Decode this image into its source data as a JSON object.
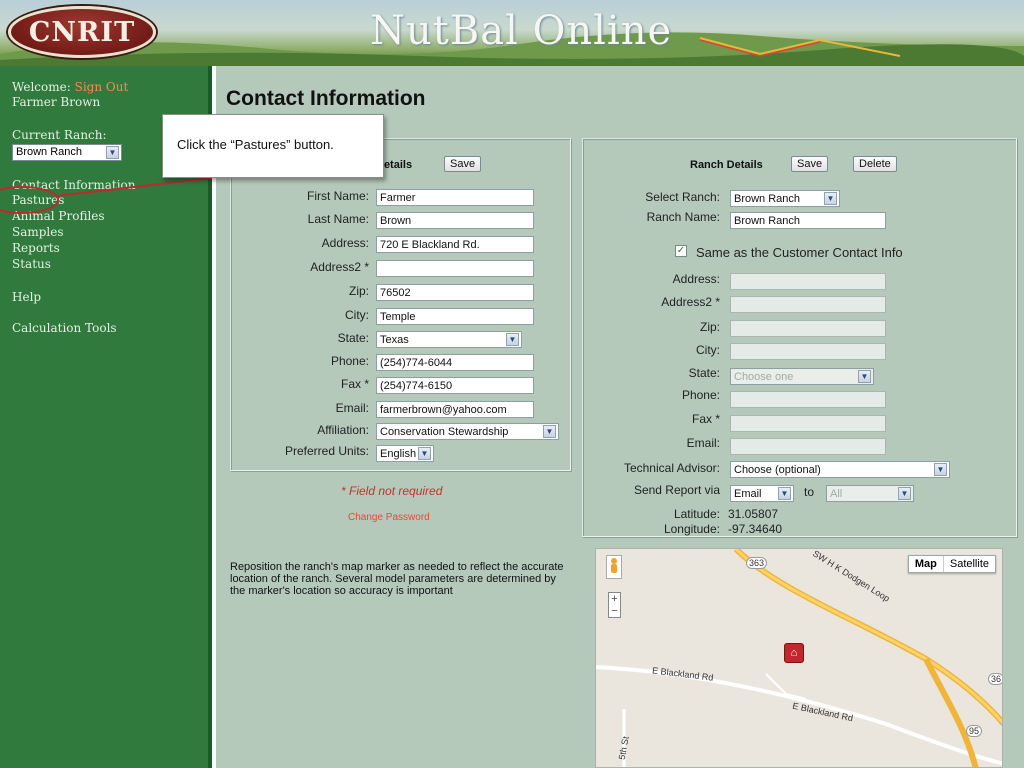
{
  "app": {
    "logo_text": "CNRIT",
    "title": "NutBal Online"
  },
  "sidebar": {
    "welcome_label": "Welcome:",
    "signout_label": "Sign Out",
    "user_name": "Farmer Brown",
    "current_ranch_label": "Current Ranch:",
    "current_ranch_value": "Brown Ranch",
    "items": [
      {
        "label": "Contact Information"
      },
      {
        "label": "Pastures"
      },
      {
        "label": "Animal Profiles"
      },
      {
        "label": "Samples"
      },
      {
        "label": "Reports"
      },
      {
        "label": "Status"
      },
      {
        "label": "Help"
      },
      {
        "label": "Calculation Tools"
      }
    ]
  },
  "page": {
    "title": "Contact Information"
  },
  "contact": {
    "section_title": "Details",
    "save_label": "Save",
    "fields": [
      {
        "label": "First Name:",
        "value": "Farmer"
      },
      {
        "label": "Last Name:",
        "value": "Brown"
      },
      {
        "label": "Address:",
        "value": "720 E Blackland Rd."
      },
      {
        "label": "Address2 *",
        "value": ""
      },
      {
        "label": "Zip:",
        "value": "76502"
      },
      {
        "label": "City:",
        "value": "Temple"
      },
      {
        "label": "State:",
        "value": "Texas"
      },
      {
        "label": "Phone:",
        "value": "(254)774-6044"
      },
      {
        "label": "Fax *",
        "value": "(254)774-6150"
      },
      {
        "label": "Email:",
        "value": "farmerbrown@yahoo.com"
      },
      {
        "label": "Affiliation:",
        "value": "Conservation Stewardship"
      },
      {
        "label": "Preferred Units:",
        "value": "English"
      }
    ],
    "field_note": "* Field not required",
    "change_password": "Change Password",
    "help_text": "Reposition the ranch's map marker as needed to reflect the accurate location of the ranch. Several model parameters are determined by the marker's location so accuracy is important"
  },
  "ranch": {
    "section_title": "Ranch Details",
    "save_label": "Save",
    "delete_label": "Delete",
    "select_ranch_label": "Select Ranch:",
    "select_ranch_value": "Brown Ranch",
    "ranch_name_label": "Ranch Name:",
    "ranch_name_value": "Brown Ranch",
    "same_as_label": "Same as the Customer Contact Info",
    "same_as_checked": true,
    "fields": [
      {
        "label": "Address:",
        "value": ""
      },
      {
        "label": "Address2 *",
        "value": ""
      },
      {
        "label": "Zip:",
        "value": ""
      },
      {
        "label": "City:",
        "value": ""
      },
      {
        "label": "State:",
        "value": "Choose one"
      },
      {
        "label": "Phone:",
        "value": ""
      },
      {
        "label": "Fax *",
        "value": ""
      },
      {
        "label": "Email:",
        "value": ""
      }
    ],
    "technical_advisor_label": "Technical Advisor:",
    "technical_advisor_value": "Choose (optional)",
    "send_report_label": "Send Report via",
    "send_report_value": "Email",
    "to_label": "to",
    "to_value": "All",
    "latitude_label": "Latitude:",
    "latitude_value": "31.05807",
    "longitude_label": "Longitude:",
    "longitude_value": "-97.34640"
  },
  "map": {
    "type_map": "Map",
    "type_satellite": "Satellite",
    "road_labels": [
      "SW H K Dodgen Loop",
      "E Blackland Rd",
      "E Blackland Rd",
      "363",
      "95",
      "36",
      "5th St"
    ]
  },
  "callout": {
    "text": "Click the “Pastures” button."
  },
  "colors": {
    "sidebar": "#2f7a3c",
    "main": "#b5c9bb",
    "highlight": "#c0282d"
  }
}
